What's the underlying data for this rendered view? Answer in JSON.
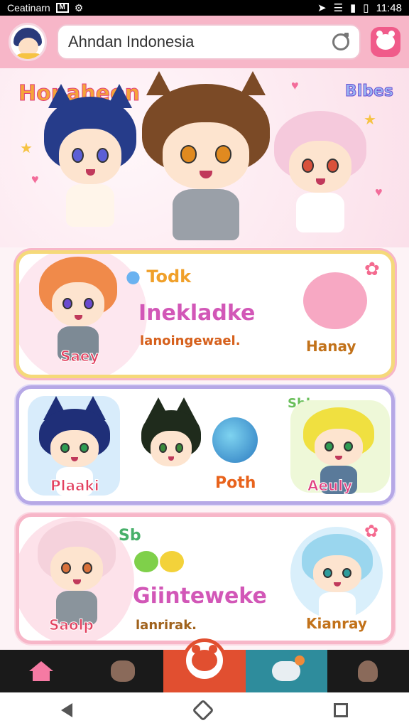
{
  "status_bar": {
    "carrier": "Ceatinarn",
    "time": "11:48"
  },
  "header": {
    "search_value": "Ahndan Indonesia"
  },
  "hero": {
    "title": "Honaheon",
    "badge": "Blbes"
  },
  "cards": [
    {
      "tag": "Todk",
      "left_name": "Saey",
      "headline": "Inekladke",
      "subtitle": "lanoingewael.",
      "right_name": "Hanay"
    },
    {
      "tag": "Sbks",
      "names": [
        "Plaaki",
        "Poth",
        "Aeuly"
      ]
    },
    {
      "tag": "Sb",
      "left_name": "Saolp",
      "headline": "Giinteweke",
      "subtitle": "lanrirak.",
      "right_name": "Kianray"
    }
  ],
  "colors": {
    "header_pink": "#f7b6c8",
    "accent_red": "#e14f30",
    "teal": "#2e8c9c"
  }
}
